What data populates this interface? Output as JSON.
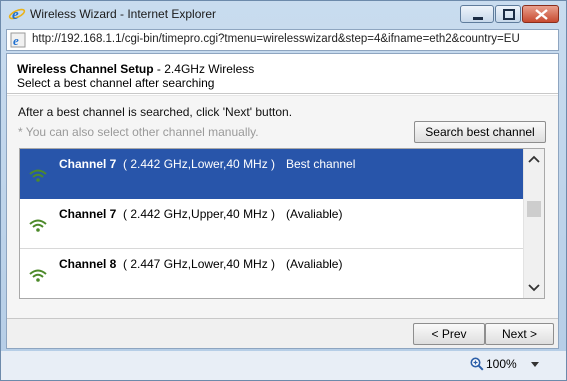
{
  "window": {
    "title": "Wireless Wizard - Internet Explorer",
    "url": "http://192.168.1.1/cgi-bin/timepro.cgi?tmenu=wirelesswizard&step=4&ifname=eth2&country=EU"
  },
  "header": {
    "title": "Wireless Channel Setup",
    "band": " - 2.4GHz Wireless",
    "subtitle": "Select a best channel after searching"
  },
  "main": {
    "info": "After a best channel is searched, click 'Next' button.",
    "note": "* You can also select other channel manually.",
    "search_button": "Search best channel",
    "channels": [
      {
        "name": "Channel 7",
        "detail": "( 2.442 GHz,Lower,40 MHz )",
        "status": "Best channel",
        "selected": true
      },
      {
        "name": "Channel 7",
        "detail": "( 2.442 GHz,Upper,40 MHz )",
        "status": "(Avaliable)",
        "selected": false
      },
      {
        "name": "Channel 8",
        "detail": "( 2.447 GHz,Lower,40 MHz )",
        "status": "(Avaliable)",
        "selected": false
      }
    ]
  },
  "footer": {
    "prev_label": "< Prev",
    "next_label": "Next >"
  },
  "statusbar": {
    "zoom": "100%"
  },
  "colors": {
    "selected_row": "#2855aa",
    "wifi_icon": "#4d8a2a",
    "close_button": "#c74a30"
  }
}
